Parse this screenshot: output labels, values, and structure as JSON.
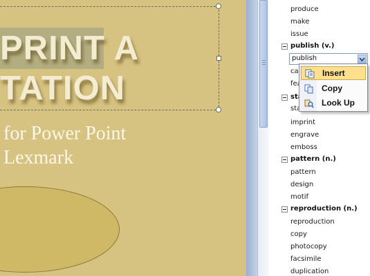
{
  "slide": {
    "title_lines": [
      "PRINT A",
      "TATION"
    ],
    "subtitle_lines": [
      "for Power Point",
      "Lexmark"
    ]
  },
  "research": {
    "words_top": [
      "produce",
      "make",
      "issue"
    ],
    "publish_heading": "publish (v.)",
    "combo_value": "publish",
    "partial_words": [
      "car",
      "fea"
    ],
    "stamp_heading_partial": "sta",
    "stamp_partial": "stamp",
    "stamp_words": [
      "imprint",
      "engrave",
      "emboss"
    ],
    "pattern_heading": "pattern (n.)",
    "pattern_words": [
      "pattern",
      "design",
      "motif"
    ],
    "reproduction_heading": "reproduction (n.)",
    "reproduction_words": [
      "reproduction",
      "copy",
      "photocopy",
      "facsimile",
      "duplication"
    ]
  },
  "menu": {
    "items": [
      {
        "label": "Insert",
        "icon": "insert-icon",
        "highlighted": true
      },
      {
        "label": "Copy",
        "icon": "copy-icon",
        "highlighted": false
      },
      {
        "label": "Look Up",
        "icon": "look-up-icon",
        "highlighted": false
      }
    ]
  },
  "colors": {
    "slide_background": "#d6c382",
    "menu_highlight": "#ffe18d",
    "pane_scrollbar": "#adc3e6"
  }
}
